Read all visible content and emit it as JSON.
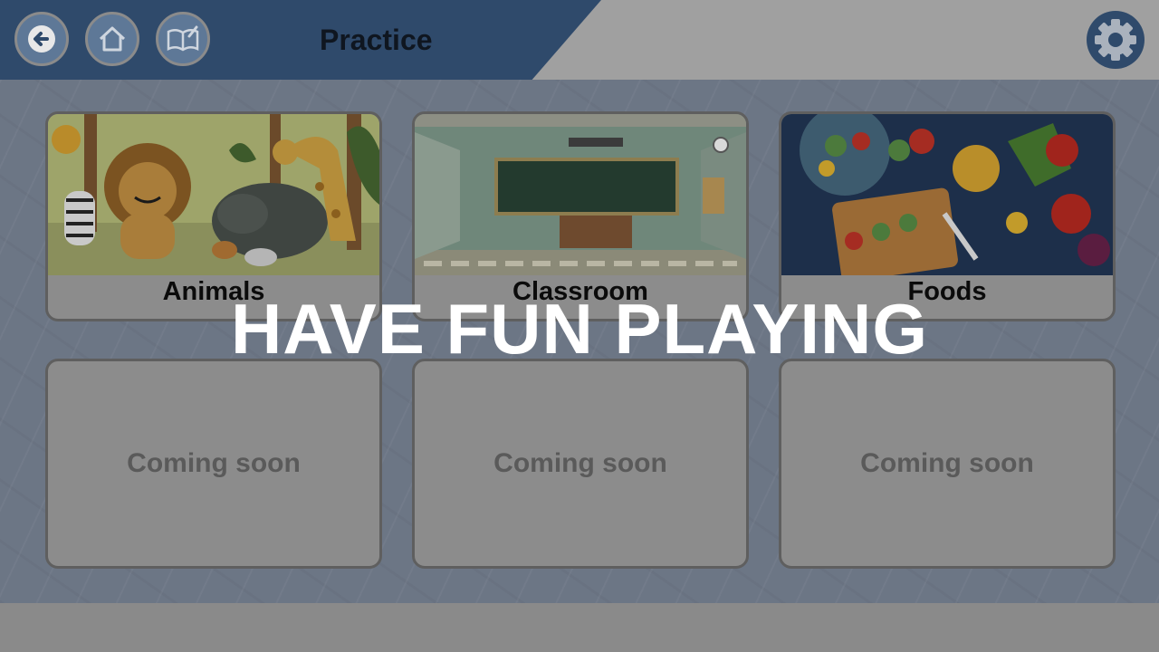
{
  "header": {
    "title": "Practice",
    "buttons": [
      {
        "name": "back",
        "icon": "arrow-left-icon"
      },
      {
        "name": "home",
        "icon": "home-icon"
      },
      {
        "name": "book",
        "icon": "book-edit-icon"
      }
    ],
    "settings_icon": "gear-icon"
  },
  "cards": [
    {
      "label": "Animals",
      "image": "animals-illustration"
    },
    {
      "label": "Classroom",
      "image": "classroom-illustration"
    },
    {
      "label": "Foods",
      "image": "foods-illustration"
    },
    {
      "label": "Coming soon"
    },
    {
      "label": "Coming soon"
    },
    {
      "label": "Coming soon"
    }
  ],
  "overlay": {
    "text": "HAVE FUN PLAYING"
  },
  "colors": {
    "header_blue": "#2f4a6b",
    "button_fill": "#5e7897",
    "gear_blue": "#2f4a6b",
    "overlay_text": "#ffffff"
  }
}
